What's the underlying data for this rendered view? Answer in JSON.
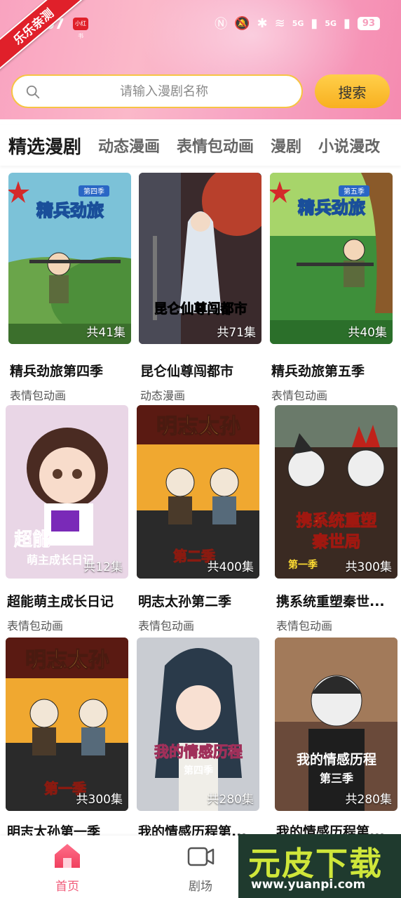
{
  "status_bar": {
    "ribbon_text": "乐乐亲测",
    "time_partial": "07",
    "badge_text": "小红书",
    "net_5g_a": "5G",
    "net_5g_b": "5G",
    "battery": "93"
  },
  "search": {
    "placeholder": "请输入漫剧名称",
    "button_label": "搜索"
  },
  "tabs": [
    {
      "label": "精选漫剧"
    },
    {
      "label": "动态漫画"
    },
    {
      "label": "表情包动画"
    },
    {
      "label": "漫剧"
    },
    {
      "label": "小说漫改"
    }
  ],
  "cards": [
    {
      "title": "精兵劲旅第四季",
      "genre": "表情包动画",
      "episodes": "共41集",
      "poster_text": "精兵劲旅",
      "season_tag": "第四季"
    },
    {
      "title": "昆仑仙尊闯都市",
      "genre": "动态漫画",
      "episodes": "共71集",
      "poster_text": "昆仑仙尊闯都市"
    },
    {
      "title": "精兵劲旅第五季",
      "genre": "表情包动画",
      "episodes": "共40集",
      "poster_text": "精兵劲旅",
      "season_tag": "第五季"
    },
    {
      "title": "超能萌主成长日记",
      "genre": "表情包动画",
      "episodes": "共12集",
      "poster_text": "超能",
      "poster_sub": "萌主成长日记"
    },
    {
      "title": "明志太孙第二季",
      "genre": "表情包动画",
      "episodes": "共400集",
      "poster_text": "明志太孙",
      "season_tag": "第二季"
    },
    {
      "title": "携系统重塑秦世...",
      "genre": "表情包动画",
      "episodes": "共300集",
      "poster_text": "携系统重塑",
      "poster_sub": "秦世局",
      "season_tag": "第一季"
    },
    {
      "title": "明志太孙第一季",
      "genre": "",
      "episodes": "共300集",
      "poster_text": "明志太孙",
      "season_tag": "第一季"
    },
    {
      "title": "我的情感历程第...",
      "genre": "",
      "episodes": "共280集",
      "poster_text": "我的情感历程",
      "season_tag": "第四季"
    },
    {
      "title": "我的情感历程第...",
      "genre": "",
      "episodes": "共280集",
      "poster_text": "我的情感历程",
      "season_tag": "第三季"
    }
  ],
  "bottom_nav": [
    {
      "label": "首页",
      "icon": "home-icon",
      "active": true
    },
    {
      "label": "剧场",
      "icon": "video-camera-icon",
      "active": false
    }
  ],
  "watermark": {
    "title": "元皮下载",
    "url": "www.yuanpi.com"
  },
  "colors": {
    "accent": "#f05a78",
    "search_border": "#f6c443",
    "search_button": "#f8b020"
  }
}
